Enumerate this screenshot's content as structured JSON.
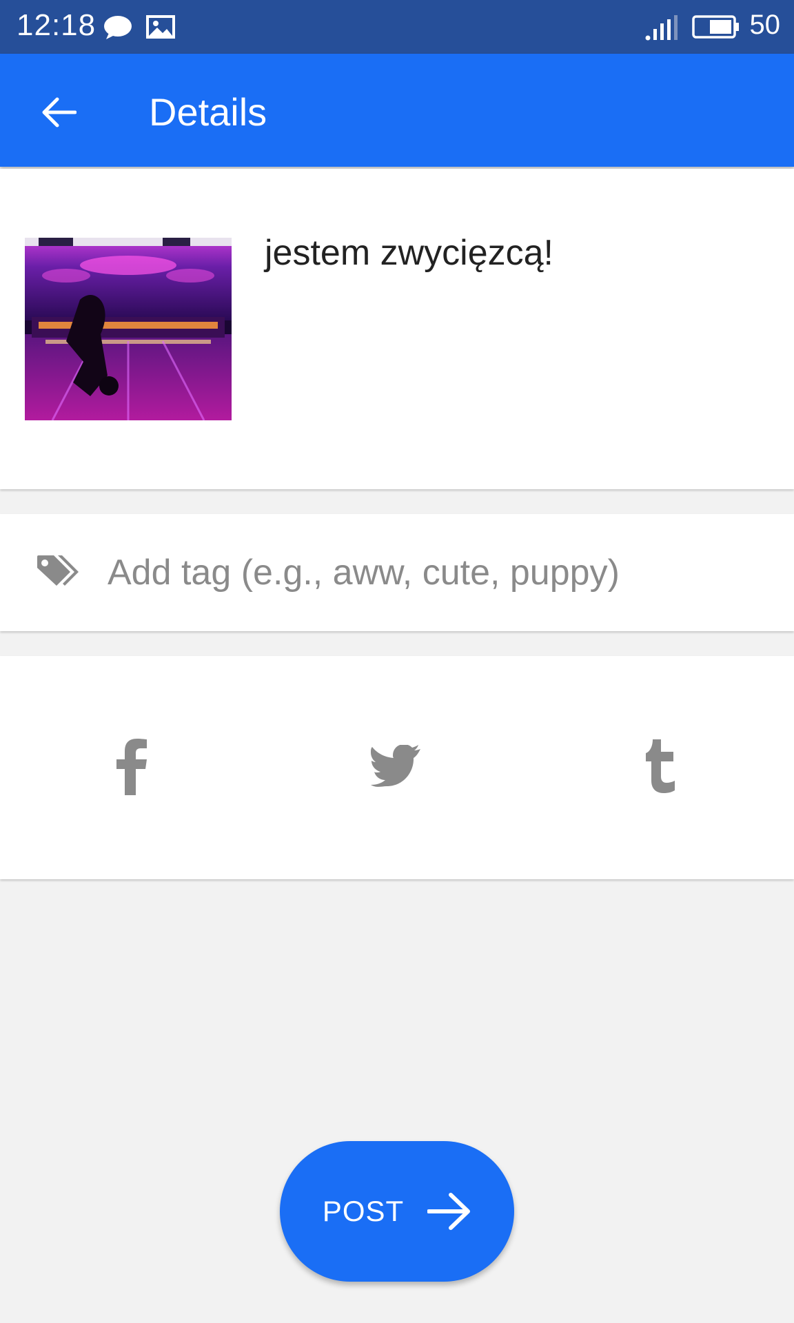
{
  "status_bar": {
    "time": "12:18",
    "battery_level": "50",
    "icons": [
      "chat-bubble-icon",
      "image-icon",
      "signal-icon",
      "battery-icon"
    ]
  },
  "app_bar": {
    "title": "Details",
    "back_icon": "arrow-left-icon"
  },
  "post": {
    "thumbnail_alt": "bowling alley photo",
    "caption": "jestem zwycięzcą!"
  },
  "tag_input": {
    "placeholder": "Add tag (e.g., aww, cute, puppy)",
    "value": "",
    "icon": "tag-icon"
  },
  "share": {
    "items": [
      {
        "name": "facebook",
        "icon": "facebook-icon"
      },
      {
        "name": "twitter",
        "icon": "twitter-icon"
      },
      {
        "name": "tumblr",
        "icon": "tumblr-icon"
      }
    ]
  },
  "post_button": {
    "label": "POST",
    "icon": "arrow-right-icon"
  },
  "colors": {
    "status_bar": "#264f99",
    "primary": "#1a6ef5",
    "background": "#f2f2f2",
    "icon_grey": "#8a8a8a"
  }
}
